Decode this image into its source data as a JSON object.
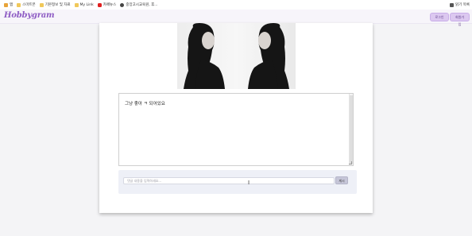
{
  "bookmarks": [
    {
      "icon": "apps-icon",
      "label": "앱"
    },
    {
      "icon": "folder-icon",
      "label": "스마트폰"
    },
    {
      "icon": "folder-icon",
      "label": "기본정보 및 자료"
    },
    {
      "icon": "folder-icon",
      "label": "My Link"
    },
    {
      "icon": "youtube-icon",
      "label": "카페뉴스"
    },
    {
      "icon": "site-icon",
      "label": "중앙고시교육원, 후..."
    }
  ],
  "bookmarks_right": {
    "icon": "reading-list-icon",
    "label": "읽기 목록"
  },
  "header": {
    "logo": "Hobbygram",
    "login_label": "로그인",
    "signup_label": "회원가입"
  },
  "post": {
    "photo_icon": "post-photo",
    "content": "그냥 좋아 ㅋ 되어있요"
  },
  "comment": {
    "placeholder": "댓글 내용을 입력하세요...",
    "submit_label": "게시"
  },
  "colors": {
    "brand": "#8e5cc4",
    "header_button": "#dcc8f0",
    "comment_panel": "#eef0f7"
  }
}
